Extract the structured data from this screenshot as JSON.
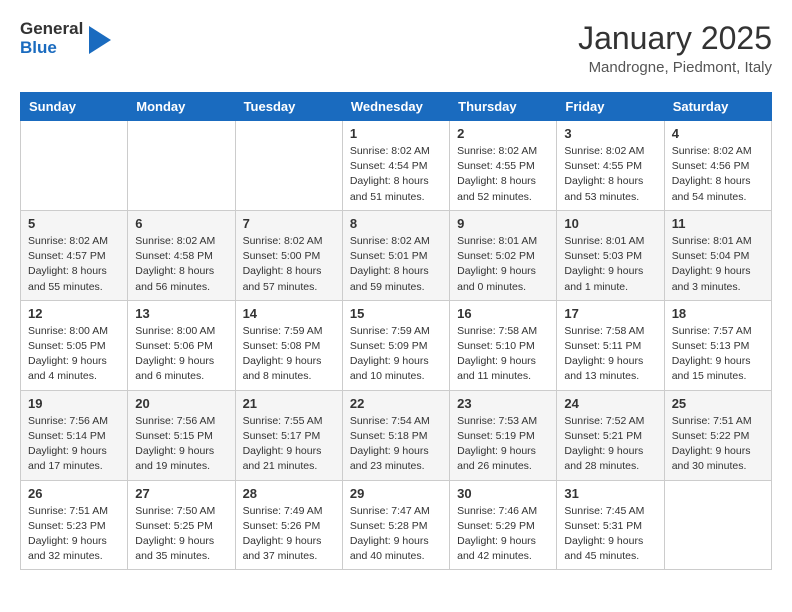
{
  "logo": {
    "general": "General",
    "blue": "Blue"
  },
  "header": {
    "title": "January 2025",
    "subtitle": "Mandrogne, Piedmont, Italy"
  },
  "weekdays": [
    "Sunday",
    "Monday",
    "Tuesday",
    "Wednesday",
    "Thursday",
    "Friday",
    "Saturday"
  ],
  "weeks": [
    [
      {
        "day": "",
        "info": ""
      },
      {
        "day": "",
        "info": ""
      },
      {
        "day": "",
        "info": ""
      },
      {
        "day": "1",
        "info": "Sunrise: 8:02 AM\nSunset: 4:54 PM\nDaylight: 8 hours\nand 51 minutes."
      },
      {
        "day": "2",
        "info": "Sunrise: 8:02 AM\nSunset: 4:55 PM\nDaylight: 8 hours\nand 52 minutes."
      },
      {
        "day": "3",
        "info": "Sunrise: 8:02 AM\nSunset: 4:55 PM\nDaylight: 8 hours\nand 53 minutes."
      },
      {
        "day": "4",
        "info": "Sunrise: 8:02 AM\nSunset: 4:56 PM\nDaylight: 8 hours\nand 54 minutes."
      }
    ],
    [
      {
        "day": "5",
        "info": "Sunrise: 8:02 AM\nSunset: 4:57 PM\nDaylight: 8 hours\nand 55 minutes."
      },
      {
        "day": "6",
        "info": "Sunrise: 8:02 AM\nSunset: 4:58 PM\nDaylight: 8 hours\nand 56 minutes."
      },
      {
        "day": "7",
        "info": "Sunrise: 8:02 AM\nSunset: 5:00 PM\nDaylight: 8 hours\nand 57 minutes."
      },
      {
        "day": "8",
        "info": "Sunrise: 8:02 AM\nSunset: 5:01 PM\nDaylight: 8 hours\nand 59 minutes."
      },
      {
        "day": "9",
        "info": "Sunrise: 8:01 AM\nSunset: 5:02 PM\nDaylight: 9 hours\nand 0 minutes."
      },
      {
        "day": "10",
        "info": "Sunrise: 8:01 AM\nSunset: 5:03 PM\nDaylight: 9 hours\nand 1 minute."
      },
      {
        "day": "11",
        "info": "Sunrise: 8:01 AM\nSunset: 5:04 PM\nDaylight: 9 hours\nand 3 minutes."
      }
    ],
    [
      {
        "day": "12",
        "info": "Sunrise: 8:00 AM\nSunset: 5:05 PM\nDaylight: 9 hours\nand 4 minutes."
      },
      {
        "day": "13",
        "info": "Sunrise: 8:00 AM\nSunset: 5:06 PM\nDaylight: 9 hours\nand 6 minutes."
      },
      {
        "day": "14",
        "info": "Sunrise: 7:59 AM\nSunset: 5:08 PM\nDaylight: 9 hours\nand 8 minutes."
      },
      {
        "day": "15",
        "info": "Sunrise: 7:59 AM\nSunset: 5:09 PM\nDaylight: 9 hours\nand 10 minutes."
      },
      {
        "day": "16",
        "info": "Sunrise: 7:58 AM\nSunset: 5:10 PM\nDaylight: 9 hours\nand 11 minutes."
      },
      {
        "day": "17",
        "info": "Sunrise: 7:58 AM\nSunset: 5:11 PM\nDaylight: 9 hours\nand 13 minutes."
      },
      {
        "day": "18",
        "info": "Sunrise: 7:57 AM\nSunset: 5:13 PM\nDaylight: 9 hours\nand 15 minutes."
      }
    ],
    [
      {
        "day": "19",
        "info": "Sunrise: 7:56 AM\nSunset: 5:14 PM\nDaylight: 9 hours\nand 17 minutes."
      },
      {
        "day": "20",
        "info": "Sunrise: 7:56 AM\nSunset: 5:15 PM\nDaylight: 9 hours\nand 19 minutes."
      },
      {
        "day": "21",
        "info": "Sunrise: 7:55 AM\nSunset: 5:17 PM\nDaylight: 9 hours\nand 21 minutes."
      },
      {
        "day": "22",
        "info": "Sunrise: 7:54 AM\nSunset: 5:18 PM\nDaylight: 9 hours\nand 23 minutes."
      },
      {
        "day": "23",
        "info": "Sunrise: 7:53 AM\nSunset: 5:19 PM\nDaylight: 9 hours\nand 26 minutes."
      },
      {
        "day": "24",
        "info": "Sunrise: 7:52 AM\nSunset: 5:21 PM\nDaylight: 9 hours\nand 28 minutes."
      },
      {
        "day": "25",
        "info": "Sunrise: 7:51 AM\nSunset: 5:22 PM\nDaylight: 9 hours\nand 30 minutes."
      }
    ],
    [
      {
        "day": "26",
        "info": "Sunrise: 7:51 AM\nSunset: 5:23 PM\nDaylight: 9 hours\nand 32 minutes."
      },
      {
        "day": "27",
        "info": "Sunrise: 7:50 AM\nSunset: 5:25 PM\nDaylight: 9 hours\nand 35 minutes."
      },
      {
        "day": "28",
        "info": "Sunrise: 7:49 AM\nSunset: 5:26 PM\nDaylight: 9 hours\nand 37 minutes."
      },
      {
        "day": "29",
        "info": "Sunrise: 7:47 AM\nSunset: 5:28 PM\nDaylight: 9 hours\nand 40 minutes."
      },
      {
        "day": "30",
        "info": "Sunrise: 7:46 AM\nSunset: 5:29 PM\nDaylight: 9 hours\nand 42 minutes."
      },
      {
        "day": "31",
        "info": "Sunrise: 7:45 AM\nSunset: 5:31 PM\nDaylight: 9 hours\nand 45 minutes."
      },
      {
        "day": "",
        "info": ""
      }
    ]
  ]
}
